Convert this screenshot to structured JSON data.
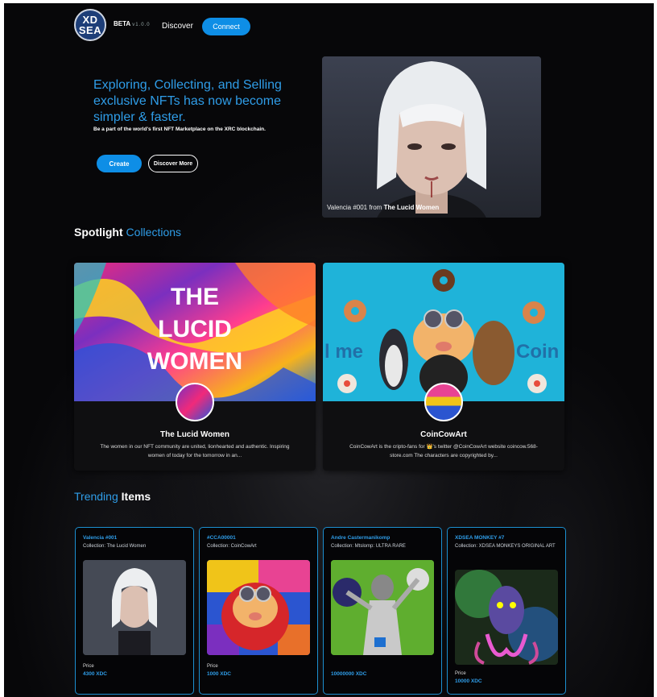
{
  "header": {
    "logo_top": "XD",
    "logo_bottom": "SEA",
    "beta": "BETA",
    "beta_version": "v1.0.0",
    "nav_discover": "Discover",
    "connect_label": "Connect"
  },
  "hero": {
    "title": "Exploring, Collecting, and Selling exclusive NFTs has now become simpler & faster.",
    "subtitle": "Be a part of the world's first NFT Marketplace on the XRC blockchain.",
    "create_label": "Create",
    "discover_more_label": "Discover More",
    "featured_caption_prefix": "Valencia #001 from",
    "featured_caption_collection": "The Lucid Women"
  },
  "spotlight": {
    "title_white": "Spotlight",
    "title_blue": "Collections",
    "collections": [
      {
        "banner_text": [
          "THE",
          "LUCID",
          "WOMEN"
        ],
        "name": "The Lucid Women",
        "description": "The women in our NFT community are united, lionhearted and authentic. Inspiring women of today for the tomorrow in an..."
      },
      {
        "banner_text_left": "l me",
        "banner_text_right": "Coin",
        "name": "CoinCowArt",
        "description": "CoinCowArt is the cripto-fans for 👑's twitter @CoinCowArt website coincow.568-store.com The characters are copyrighted by..."
      }
    ]
  },
  "trending": {
    "title_blue": "Trending",
    "title_white": "Items",
    "price_label": "Price",
    "items": [
      {
        "name": "Valencia #001",
        "collection": "Collection: The Lucid Women",
        "price": "4300 XDC"
      },
      {
        "name": "#CCA00001",
        "collection": "Collection: CoinCowArt",
        "price": "1000 XDC"
      },
      {
        "name": "Andre Castermanikomp",
        "collection": "Collection: Mtslomp: ULTRA RARE",
        "price": "10000000 XDC"
      },
      {
        "name": "XDSEA MONKEY #7",
        "collection": "Collection: XDSEA MONKEYS ORIGINAL ART",
        "price": "10000 XDC"
      }
    ]
  },
  "colors": {
    "accent": "#0e8ee6",
    "accent_text": "#2f9de8",
    "background": "#070709",
    "card_border": "#1c8fd0"
  }
}
